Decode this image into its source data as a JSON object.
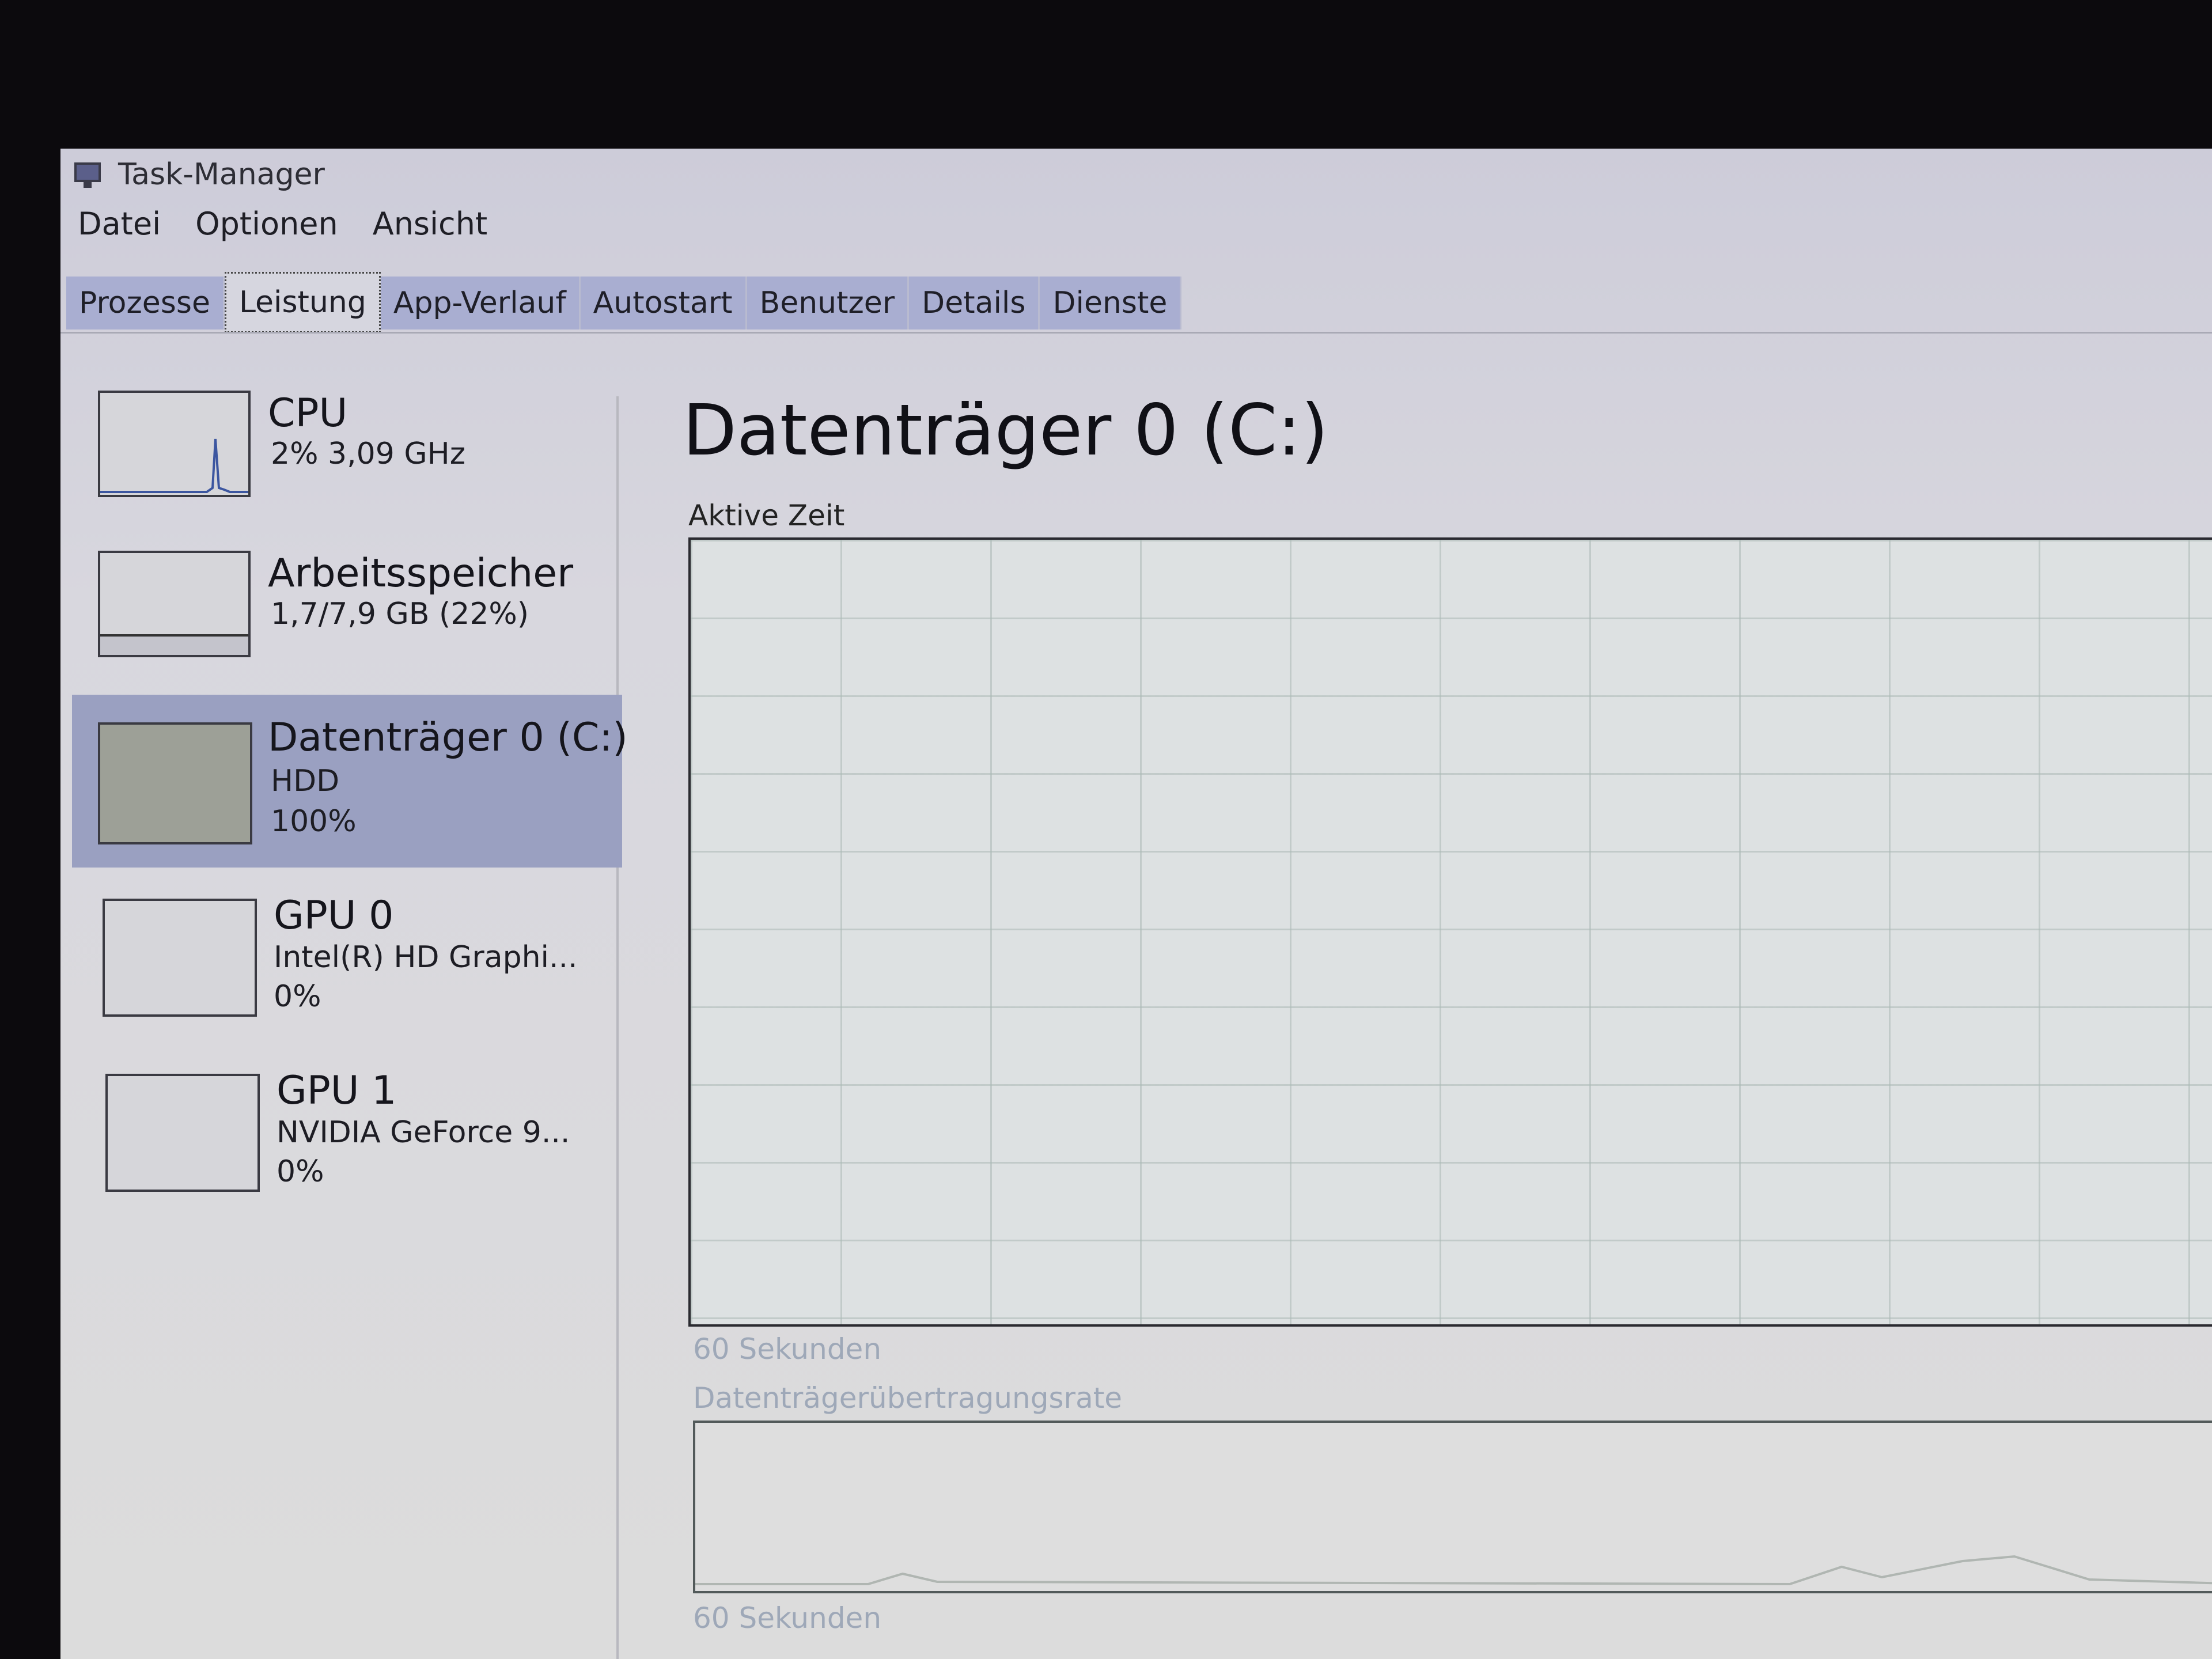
{
  "window": {
    "title": "Task-Manager"
  },
  "menu": [
    "Datei",
    "Optionen",
    "Ansicht"
  ],
  "tabs": [
    {
      "label": "Prozesse"
    },
    {
      "label": "Leistung"
    },
    {
      "label": "App-Verlauf"
    },
    {
      "label": "Autostart"
    },
    {
      "label": "Benutzer"
    },
    {
      "label": "Details"
    },
    {
      "label": "Dienste"
    }
  ],
  "active_tab": "Leistung",
  "sidebar": {
    "items": [
      {
        "title": "CPU",
        "sub": "2% 3,09 GHz",
        "value": ""
      },
      {
        "title": "Arbeitsspeicher",
        "sub": "1,7/7,9 GB (22%)",
        "value": ""
      },
      {
        "title": "Datenträger 0 (C:)",
        "sub": "HDD",
        "value": "100%"
      },
      {
        "title": "GPU 0",
        "sub": "Intel(R) HD Graphi...",
        "value": "0%"
      },
      {
        "title": "GPU 1",
        "sub": "NVIDIA GeForce 9...",
        "value": "0%"
      }
    ],
    "selected_index": 2
  },
  "main": {
    "title": "Datenträger 0 (C:)",
    "graph1_label": "Aktive Zeit",
    "graph1_footer": "60 Sekunden",
    "graph2_label": "Datenträgerübertragungsrate",
    "graph2_footer": "60 Sekunden"
  },
  "colors": {
    "tab_bg": "#a9aed1",
    "selected_item_bg": "#9aa0c1",
    "graph_grid": "#aab9b4"
  }
}
